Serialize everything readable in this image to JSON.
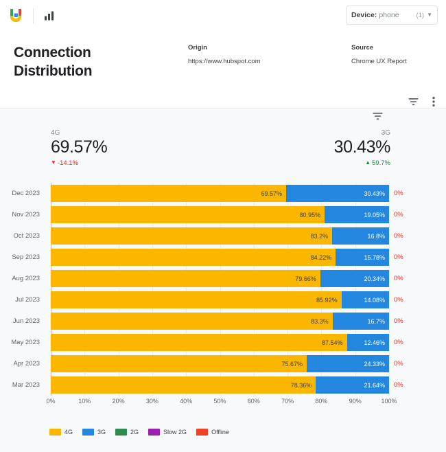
{
  "topbar": {
    "logo_icon": "crux-dashboard-logo-icon",
    "chart_icon": "bar-chart-icon",
    "device": {
      "label": "Device:",
      "value": "phone",
      "count": "(1)",
      "caret_icon": "chevron-down-icon"
    }
  },
  "header": {
    "title": "Connection Distribution",
    "origin_label": "Origin",
    "origin_value": "https://www.hubspot.com",
    "source_label": "Source",
    "source_value": "Chrome UX Report"
  },
  "toolbar": {
    "filter_icon": "filter-icon",
    "more_icon": "more-vertical-icon"
  },
  "panel": {
    "filter_icon": "filter-icon",
    "kpi_left": {
      "name": "4G",
      "value": "69.57%",
      "delta": "-14.1%",
      "delta_direction": "down",
      "delta_arrow": "▼",
      "delta_color": "#d93025"
    },
    "kpi_right": {
      "name": "3G",
      "value": "30.43%",
      "delta": "59.7%",
      "delta_direction": "up",
      "delta_arrow": "▲",
      "delta_color": "#1e8e3e"
    }
  },
  "colors": {
    "4g": "#fbb600",
    "3g": "#2387e0",
    "2g": "#2e8b4f",
    "slow_2g": "#9c1fb5",
    "offline": "#ef4123",
    "panel_bg": "#f8f9fa",
    "grid": "#e8eaed",
    "axis": "#bdc1c6",
    "text_primary": "#202124",
    "text_secondary": "#5f6368",
    "negative": "#d93025",
    "positive": "#1e8e3e"
  },
  "chart_data": {
    "type": "bar",
    "title": "Connection Distribution",
    "xlabel": "",
    "ylabel": "",
    "xlim": [
      0,
      100
    ],
    "grid": true,
    "stacked": true,
    "orientation": "horizontal",
    "legend_position": "bottom-left",
    "xticks": [
      "0%",
      "10%",
      "20%",
      "30%",
      "40%",
      "50%",
      "60%",
      "70%",
      "80%",
      "90%",
      "100%"
    ],
    "xtick_values": [
      0,
      10,
      20,
      30,
      40,
      50,
      60,
      70,
      80,
      90,
      100
    ],
    "categories": [
      "Dec 2023",
      "Nov 2023",
      "Oct 2023",
      "Sep 2023",
      "Aug 2023",
      "Jul 2023",
      "Jun 2023",
      "May 2023",
      "Apr 2023",
      "Mar 2023"
    ],
    "series": [
      {
        "name": "4G",
        "color": "#fbb600",
        "values": [
          69.57,
          80.95,
          83.2,
          84.22,
          79.66,
          85.92,
          83.3,
          87.54,
          75.67,
          78.36
        ],
        "labels": [
          "69.57%",
          "80.95%",
          "83.2%",
          "84.22%",
          "79.66%",
          "85.92%",
          "83.3%",
          "87.54%",
          "75.67%",
          "78.36%"
        ]
      },
      {
        "name": "3G",
        "color": "#2387e0",
        "values": [
          30.43,
          19.05,
          16.8,
          15.78,
          20.34,
          14.08,
          16.7,
          12.46,
          24.33,
          21.64
        ],
        "labels": [
          "30.43%",
          "19.05%",
          "16.8%",
          "15.78%",
          "20.34%",
          "14.08%",
          "16.7%",
          "12.46%",
          "24.33%",
          "21.64%"
        ]
      },
      {
        "name": "2G",
        "color": "#2e8b4f",
        "values": [
          0,
          0,
          0,
          0,
          0,
          0,
          0,
          0,
          0,
          0
        ],
        "labels": []
      },
      {
        "name": "Slow 2G",
        "color": "#9c1fb5",
        "values": [
          0,
          0,
          0,
          0,
          0,
          0,
          0,
          0,
          0,
          0
        ],
        "labels": []
      },
      {
        "name": "Offline",
        "color": "#ef4123",
        "values": [
          0,
          0,
          0,
          0,
          0,
          0,
          0,
          0,
          0,
          0
        ],
        "labels": []
      }
    ],
    "row_annotations": [
      "0%",
      "0%",
      "0%",
      "0%",
      "0%",
      "0%",
      "0%",
      "0%",
      "0%",
      "0%"
    ],
    "legend": [
      {
        "label": "4G",
        "color": "#fbb600"
      },
      {
        "label": "3G",
        "color": "#2387e0"
      },
      {
        "label": "2G",
        "color": "#2e8b4f"
      },
      {
        "label": "Slow 2G",
        "color": "#9c1fb5"
      },
      {
        "label": "Offline",
        "color": "#ef4123"
      }
    ]
  }
}
